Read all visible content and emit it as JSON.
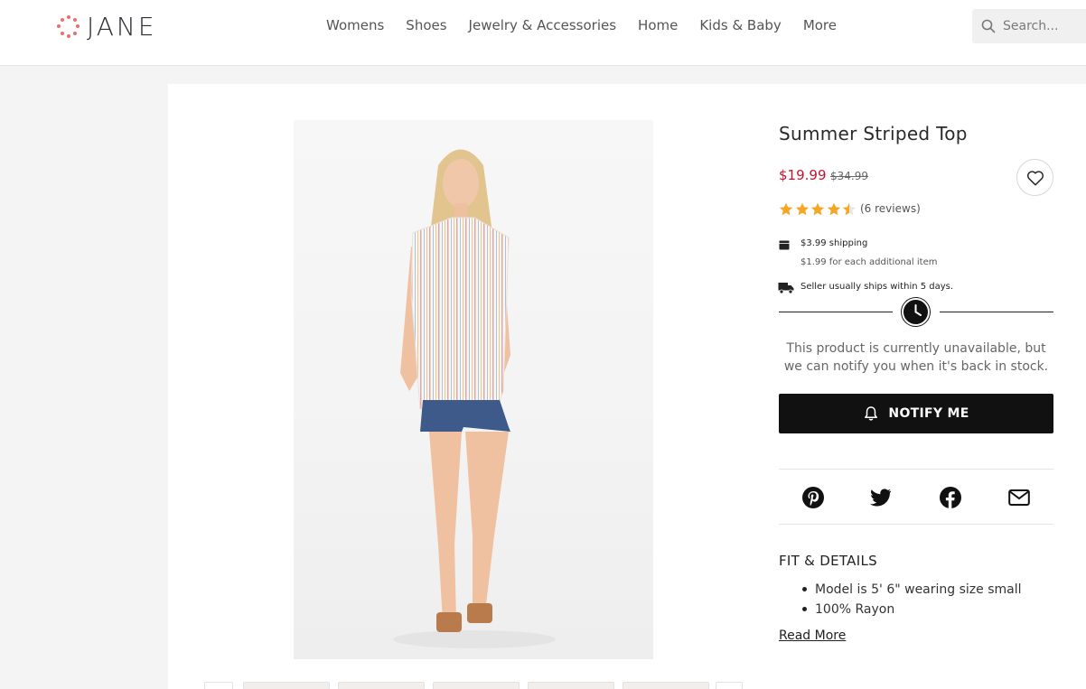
{
  "header": {
    "brand": "JANE",
    "nav": [
      "Womens",
      "Shoes",
      "Jewelry & Accessories",
      "Home",
      "Kids & Baby",
      "More"
    ],
    "search_placeholder": "Search..."
  },
  "product": {
    "title": "Summer Striped Top",
    "price": "$19.99",
    "original_price": "$34.99",
    "rating": 4.5,
    "reviews_text": "(6 reviews)",
    "shipping_main": "$3.99 shipping",
    "shipping_sub": "$1.99 for each additional item",
    "ships_within": "Seller usually ships within 5 days.",
    "unavailable_text": "This product is currently unavailable, but we can notify you when it's back in stock.",
    "notify_label": "NOTIFY ME",
    "share": [
      "pinterest-icon",
      "twitter-icon",
      "facebook-icon",
      "email-icon"
    ],
    "fit_heading": "FIT & DETAILS",
    "fit_details": [
      "Model is 5' 6\" wearing size small",
      "100% Rayon"
    ],
    "read_more": "Read More"
  },
  "colors": {
    "accent_price": "#c8102e",
    "star": "#f5a623",
    "logo_dots": "#f06b6b",
    "button": "#111111"
  }
}
